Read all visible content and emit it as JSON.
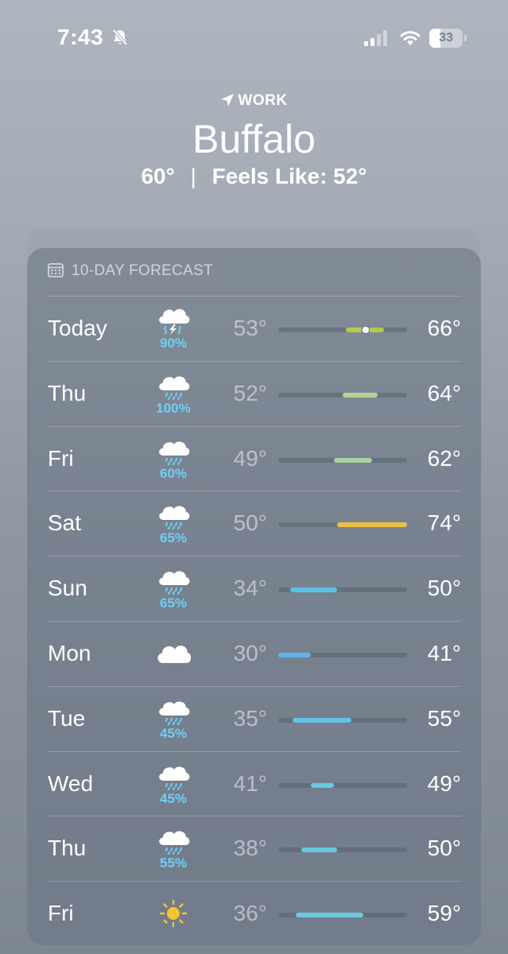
{
  "status": {
    "time": "7:43",
    "battery": "33",
    "battery_level": 0.33
  },
  "location": {
    "label": "WORK",
    "city": "Buffalo",
    "current_temp": "60°",
    "separator": "|",
    "feels_like": "Feels Like: 52°"
  },
  "forecast": {
    "title": "10-DAY FORECAST",
    "range_min": 30,
    "range_max": 74,
    "days": [
      {
        "day": "Today",
        "icon": "thunderstorm-icon",
        "precip": "90%",
        "low": "53°",
        "high": "66°",
        "lo": 53,
        "hi": 66,
        "color": "#b5cc48",
        "current": 60
      },
      {
        "day": "Thu",
        "icon": "rain-icon",
        "precip": "100%",
        "low": "52°",
        "high": "64°",
        "lo": 52,
        "hi": 64,
        "color": "#b9d18f"
      },
      {
        "day": "Fri",
        "icon": "rain-icon",
        "precip": "60%",
        "low": "49°",
        "high": "62°",
        "lo": 49,
        "hi": 62,
        "color": "#a6d2a0"
      },
      {
        "day": "Sat",
        "icon": "rain-icon",
        "precip": "65%",
        "low": "50°",
        "high": "74°",
        "lo": 50,
        "hi": 74,
        "color": "#e8c145"
      },
      {
        "day": "Sun",
        "icon": "rain-icon",
        "precip": "65%",
        "low": "34°",
        "high": "50°",
        "lo": 34,
        "hi": 50,
        "color": "#5cc1e6"
      },
      {
        "day": "Mon",
        "icon": "cloud-icon",
        "precip": "",
        "low": "30°",
        "high": "41°",
        "lo": 30,
        "hi": 41,
        "color": "#5db5e8"
      },
      {
        "day": "Tue",
        "icon": "rain-icon",
        "precip": "45%",
        "low": "35°",
        "high": "55°",
        "lo": 35,
        "hi": 55,
        "color": "#63c3e5"
      },
      {
        "day": "Wed",
        "icon": "rain-icon",
        "precip": "45%",
        "low": "41°",
        "high": "49°",
        "lo": 41,
        "hi": 49,
        "color": "#68c8df"
      },
      {
        "day": "Thu",
        "icon": "rain-icon",
        "precip": "55%",
        "low": "38°",
        "high": "50°",
        "lo": 38,
        "hi": 50,
        "color": "#66c6e0"
      },
      {
        "day": "Fri",
        "icon": "sun-icon",
        "precip": "",
        "low": "36°",
        "high": "59°",
        "lo": 36,
        "hi": 59,
        "color": "#6fcadb"
      }
    ]
  }
}
